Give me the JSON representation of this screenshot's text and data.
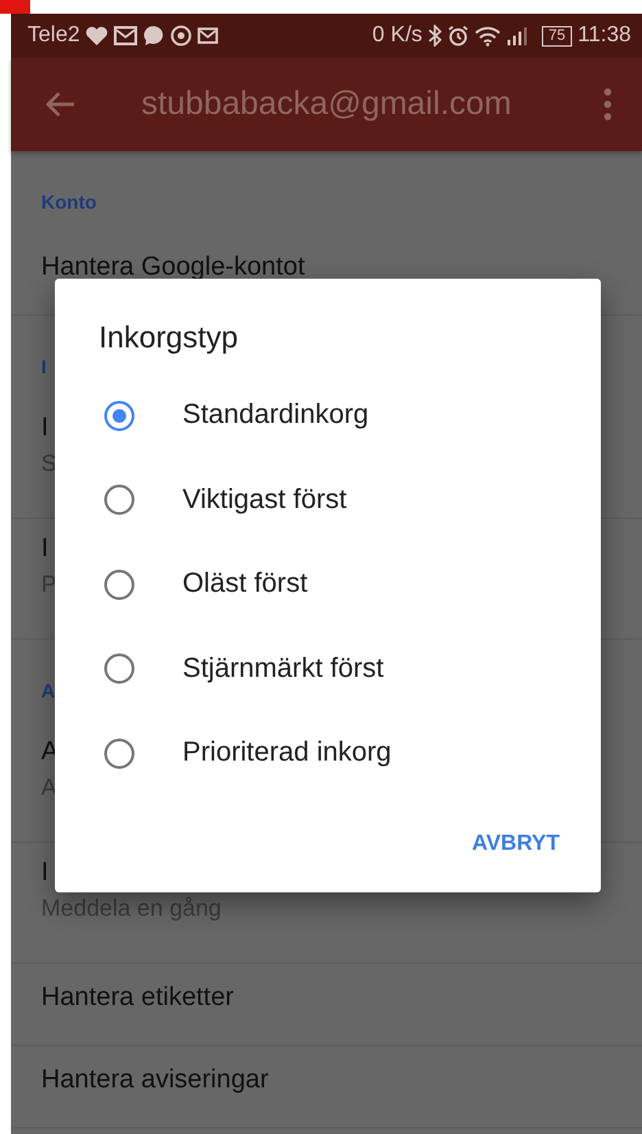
{
  "status_bar": {
    "carrier": "Tele2",
    "speed": "0 K/s",
    "battery": "75",
    "time": "11:38"
  },
  "app_bar": {
    "title": "stubbabacka@gmail.com"
  },
  "settings": [
    {
      "kind": "header",
      "title": "Konto"
    },
    {
      "kind": "item",
      "title": "Hantera Google-kontot"
    },
    {
      "kind": "header",
      "title": "I"
    },
    {
      "kind": "item",
      "title": "I",
      "subtitle": "S"
    },
    {
      "kind": "item",
      "title": "I",
      "subtitle": "P"
    },
    {
      "kind": "header",
      "title": "A"
    },
    {
      "kind": "item",
      "title": "A",
      "subtitle": "A"
    },
    {
      "kind": "item",
      "title": "I",
      "subtitle": "Meddela en gång"
    },
    {
      "kind": "item",
      "title": "Hantera etiketter"
    },
    {
      "kind": "item",
      "title": "Hantera aviseringar"
    }
  ],
  "dialog": {
    "title": "Inkorgstyp",
    "options": [
      {
        "label": "Standardinkorg",
        "selected": true
      },
      {
        "label": "Viktigast först",
        "selected": false
      },
      {
        "label": "Oläst först",
        "selected": false
      },
      {
        "label": "Stjärnmärkt först",
        "selected": false
      },
      {
        "label": "Prioriterad inkorg",
        "selected": false
      }
    ],
    "button": "AVBRYT"
  }
}
